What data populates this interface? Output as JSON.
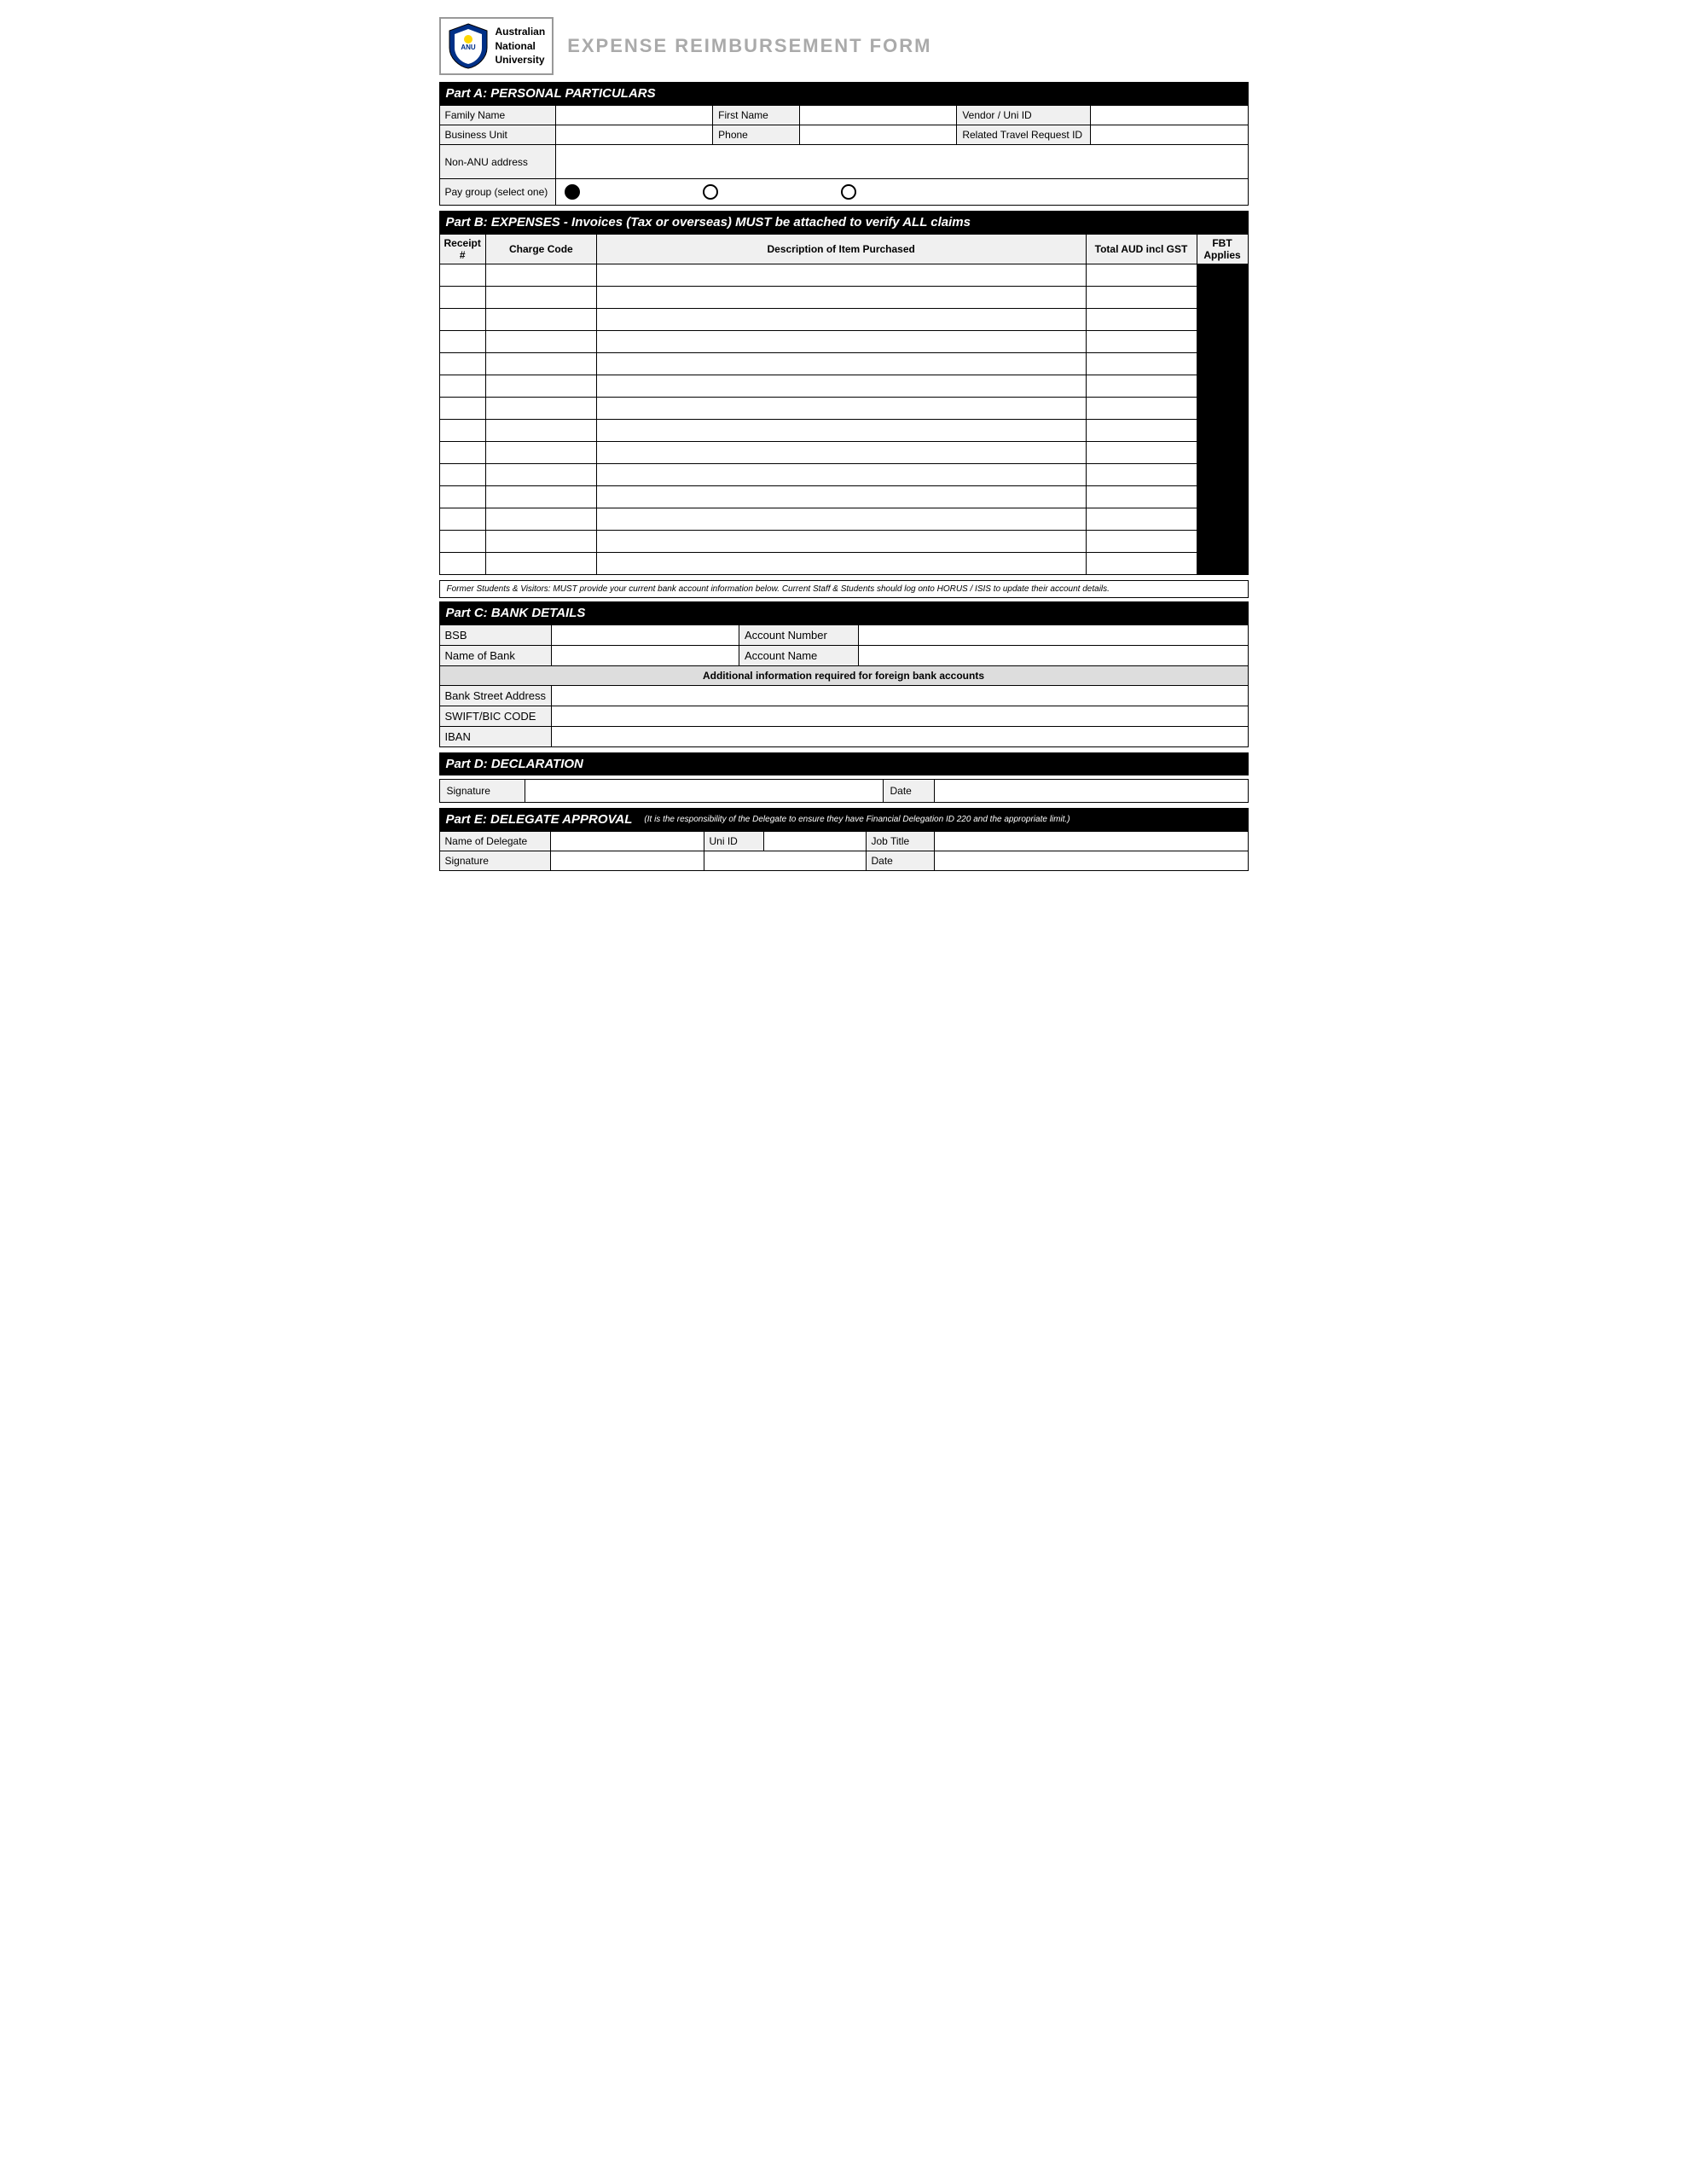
{
  "header": {
    "university_name": "Australian\nNational\nUniversity",
    "form_title": "EXPENSE REIMBURSEMENT FORM"
  },
  "part_a": {
    "section_title": "Part A: PERSONAL PARTICULARS",
    "fields": {
      "family_name_label": "Family Name",
      "first_name_label": "First Name",
      "vendor_uni_id_label": "Vendor / Uni ID",
      "business_unit_label": "Business Unit",
      "phone_label": "Phone",
      "related_travel_label": "Related Travel Request ID",
      "non_anu_address_label": "Non-ANU address",
      "pay_group_label": "Pay group (select one)"
    },
    "pay_group_options": [
      "",
      "",
      ""
    ]
  },
  "part_b": {
    "section_title": "Part B: EXPENSES - Invoices (Tax or overseas) MUST be attached to verify ALL claims",
    "columns": {
      "receipt": "Receipt\n#",
      "charge_code": "Charge Code",
      "description": "Description of Item Purchased",
      "total_aud": "Total AUD incl GST",
      "fbt_applies": "FBT\nApplies"
    },
    "num_rows": 14
  },
  "bank_notice": "Former Students & Visitors: MUST provide your current bank account information below. Current Staff & Students should log onto HORUS / ISIS to update their account details.",
  "part_c": {
    "section_title": "Part C: BANK DETAILS",
    "fields": {
      "bsb_label": "BSB",
      "account_number_label": "Account Number",
      "name_of_bank_label": "Name of Bank",
      "account_name_label": "Account Name"
    },
    "foreign_header": "Additional information required for foreign bank accounts",
    "foreign_fields": {
      "bank_street_label": "Bank Street Address",
      "swift_bic_label": "SWIFT/BIC CODE",
      "iban_label": "IBAN"
    }
  },
  "part_d": {
    "section_title": "Part D: DECLARATION",
    "signature_label": "Signature",
    "date_label": "Date"
  },
  "part_e": {
    "section_title": "Part E: DELEGATE APPROVAL",
    "note": "(It is the responsibility of the Delegate to ensure they have Financial Delegation ID 220 and the appropriate limit.)",
    "name_of_delegate_label": "Name of Delegate",
    "uni_id_label": "Uni ID",
    "job_title_label": "Job Title",
    "signature_label": "Signature",
    "date_label": "Date"
  }
}
